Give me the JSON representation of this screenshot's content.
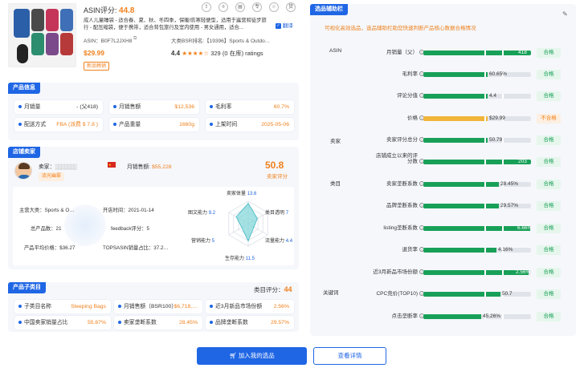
{
  "product": {
    "asin_score_label": "ASIN评分:",
    "asin_score": "44.8",
    "title": "成人儿童睡袋 - 适合春、夏、秋、冬四季，保暖/防寒轻便型，适用于露营和徒步旅行 - 配压缩袋，便于携带，适合背包旅行及室内使用 - 男女通用，适合...",
    "translate_label": "翻译",
    "asin_label": "ASIN：B0F7L2JXH8",
    "category_rank": "大类BSR排名:【19396】Sports & Outdo…",
    "price": "$29.99",
    "rating": "4.4",
    "reviews": "329 (0 在库) ratings",
    "new_tag": "新品畅销",
    "toolbar_icons": [
      "share-icon",
      "compare-icon",
      "document-icon",
      "pin-icon",
      "star-icon",
      "supply-icon"
    ],
    "toolbar_labels": [
      "⇪",
      "⌾",
      "▤",
      "专",
      "☆",
      "货"
    ]
  },
  "product_info": {
    "header": "产品信息",
    "cards": [
      {
        "label": "月销量",
        "value": "- (父418)"
      },
      {
        "label": "月销售额",
        "value": "$12,536"
      },
      {
        "label": "毛利率",
        "value": "60.7%"
      },
      {
        "label": "配送方式",
        "value": "FBA (派费 $ 7.8 )"
      },
      {
        "label": "产品重量",
        "value": "1660g"
      },
      {
        "label": "上架时间",
        "value": "2025-05-06"
      }
    ]
  },
  "seller": {
    "header": "店铺卖家",
    "name_label": "卖家：",
    "name_masked": "▒▒▒▒▒▒▒",
    "sales_label": "月销售额:",
    "sales_value": "$55,228",
    "tag": "流光幽翠",
    "score": "50.8",
    "score_label": "卖家评分",
    "main_category": "主营大类：Sports & O…",
    "open_time": "开店时间：2021-01-14",
    "total_products": "总产品数：21",
    "feedback": "feedback评分：5",
    "avg_price": "产品平均价格：$36.27",
    "top_asin": "TOPSASIN销量占比：37.2…"
  },
  "radar": {
    "axes": [
      {
        "label": "卖家体量",
        "value": "13.6"
      },
      {
        "label": "类目透明",
        "value": "7"
      },
      {
        "label": "流量能力",
        "value": "4.4"
      },
      {
        "label": "生存能力",
        "value": "11.5"
      },
      {
        "label": "营销能力",
        "value": "5"
      },
      {
        "label": "图文能力",
        "value": "9.2"
      }
    ]
  },
  "sub_category": {
    "header": "产品子类目",
    "score_label": "类目评分：",
    "score": "44",
    "cards": [
      {
        "label": "子类目名称",
        "value": "Sleeping Bags"
      },
      {
        "label": "月销售额（BSR100）",
        "value": "$6,718,…"
      },
      {
        "label": "近3月新品市场份额",
        "value": "2.56%"
      },
      {
        "label": "中国卖家销量占比",
        "value": "55.67%"
      },
      {
        "label": "卖家垄断系数",
        "value": "28.45%"
      },
      {
        "label": "品牌垄断系数",
        "value": "29.57%"
      }
    ]
  },
  "assist": {
    "header": "选品辅助栏",
    "subtitle": "可视化高效选品，选品辅助栏助您快速判断产品核心数据合格情况",
    "groups": [
      "ASIN",
      "卖家",
      "类目",
      "关键词"
    ],
    "rows": [
      {
        "label": "月销量（父）",
        "fill": 1.0,
        "value": "418",
        "badge": "合格",
        "ok": true
      },
      {
        "label": "毛利率",
        "fill": 0.6,
        "value": "60.65%",
        "badge": "合格",
        "ok": true
      },
      {
        "label": "评论分值",
        "fill": 0.6,
        "value": "4.4",
        "badge": "合格",
        "ok": true
      },
      {
        "label": "价格",
        "fill": 0.6,
        "value": "$29.99",
        "badge": "不合格",
        "ok": false
      },
      {
        "label": "卖家评分总分",
        "fill": 0.6,
        "value": "50.79",
        "badge": "合格",
        "ok": true
      },
      {
        "label": "店铺成立以来的评分数",
        "fill": 1.0,
        "value": "203",
        "badge": "合格",
        "ok": true
      },
      {
        "label": "卖家垄断系数",
        "fill": 0.7,
        "value": "28.45%",
        "badge": "合格",
        "ok": true
      },
      {
        "label": "品牌垄断系数",
        "fill": 0.7,
        "value": "29.57%",
        "badge": "合格",
        "ok": true
      },
      {
        "label": "listing垄断系数",
        "fill": 0.99,
        "value": "6.66%",
        "badge": "合格",
        "ok": true
      },
      {
        "label": "退货率",
        "fill": 0.68,
        "value": "4.16%",
        "badge": "合格",
        "ok": true
      },
      {
        "label": "近3月新品市场份额",
        "fill": 0.98,
        "value": "2.56%",
        "badge": "合格",
        "ok": true
      },
      {
        "label": "CPC竞价(TOP10)",
        "fill": 0.72,
        "value": "50.7",
        "badge": "合格",
        "ok": true
      },
      {
        "label": "点击垄断率",
        "fill": 0.54,
        "value": "45.26%",
        "badge": "合格",
        "ok": true
      }
    ]
  },
  "buttons": {
    "add": "加入我的选品",
    "detail": "查看详情"
  },
  "colors": {
    "accent": "#1f66e5",
    "orange": "#f0811c",
    "green": "#18a058",
    "yellow": "#f1b53a"
  }
}
